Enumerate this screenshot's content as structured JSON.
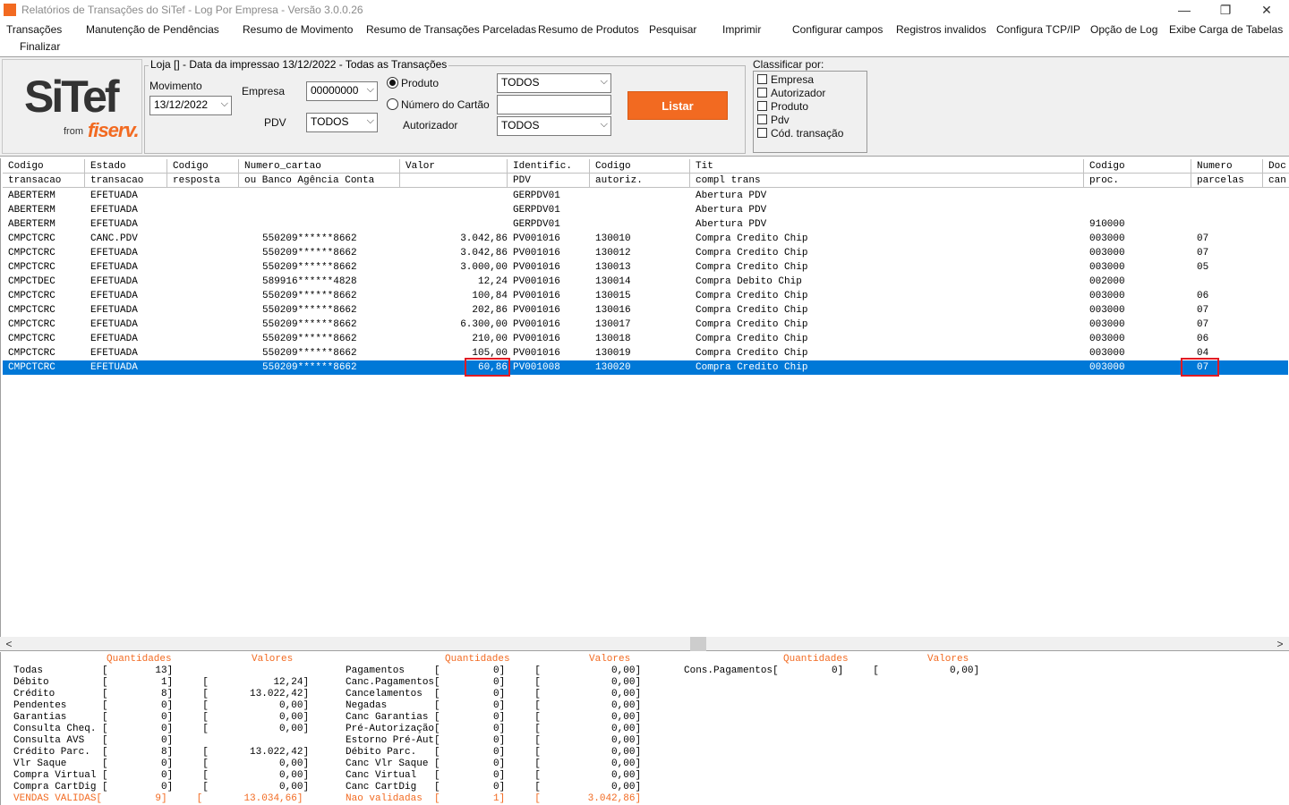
{
  "window": {
    "title": "Relatórios de Transações do SiTef - Log Por Empresa - Versão 3.0.0.26",
    "min_label": "—",
    "max_label": "❐",
    "close_label": "✕"
  },
  "menu": [
    "Transações",
    "Manutenção de Pendências",
    "Resumo de Movimento",
    "Resumo de Transações Parceladas",
    "Resumo de Produtos",
    "Pesquisar",
    "Imprimir",
    "Configurar campos",
    "Registros invalidos",
    "Configura TCP/IP",
    "Opção de Log",
    "Exibe Carga de Tabelas",
    "Finalizar"
  ],
  "logo": {
    "main": "SiTef",
    "from": "from",
    "brand": "fiserv."
  },
  "filters": {
    "group_title": "Loja [] - Data da impressao 13/12/2022 - Todas as Transações",
    "movimento_label": "Movimento",
    "movimento_value": "13/12/2022",
    "empresa_label": "Empresa",
    "empresa_value": "00000000",
    "pdv_label": "PDV",
    "pdv_value": "TODOS",
    "produto_label": "Produto",
    "produto_value": "TODOS",
    "numero_cartao_label": "Número do Cartão",
    "numero_cartao_value": "",
    "autorizador_label": "Autorizador",
    "autorizador_value": "TODOS",
    "listar_label": "Listar",
    "arrow": "⌵"
  },
  "classificar": {
    "title": "Classificar por:",
    "options": [
      "Empresa",
      "Autorizador",
      "Produto",
      "Pdv",
      "Cód. transação"
    ]
  },
  "grid": {
    "header_top": [
      "Codigo",
      "Estado",
      "Codigo",
      "Numero_cartao",
      "Valor",
      "Identific.",
      "Codigo",
      "Tit",
      "Codigo",
      "Numero",
      "Doc"
    ],
    "header_bottom": [
      "transacao",
      "transacao",
      "resposta",
      "ou Banco Agência Conta",
      "",
      "PDV",
      "autoriz.",
      "compl trans",
      "proc.",
      "parcelas",
      "can"
    ],
    "rows": [
      [
        "ABERTERM",
        "EFETUADA",
        "",
        "",
        "",
        "GERPDV01",
        "",
        "Abertura PDV",
        "",
        ""
      ],
      [
        "ABERTERM",
        "EFETUADA",
        "",
        "",
        "",
        "GERPDV01",
        "",
        "Abertura PDV",
        "",
        ""
      ],
      [
        "ABERTERM",
        "EFETUADA",
        "",
        "",
        "",
        "GERPDV01",
        "",
        "Abertura PDV",
        "910000",
        ""
      ],
      [
        "CMPCTCRC",
        "CANC.PDV",
        "",
        "550209******8662",
        "3.042,86",
        "PV001016",
        "130010",
        "Compra Credito Chip",
        "003000",
        "07"
      ],
      [
        "CMPCTCRC",
        "EFETUADA",
        "",
        "550209******8662",
        "3.042,86",
        "PV001016",
        "130012",
        "Compra Credito Chip",
        "003000",
        "07"
      ],
      [
        "CMPCTCRC",
        "EFETUADA",
        "",
        "550209******8662",
        "3.000,00",
        "PV001016",
        "130013",
        "Compra Credito Chip",
        "003000",
        "05"
      ],
      [
        "CMPCTDEC",
        "EFETUADA",
        "",
        "589916******4828",
        "12,24",
        "PV001016",
        "130014",
        "Compra Debito Chip",
        "002000",
        ""
      ],
      [
        "CMPCTCRC",
        "EFETUADA",
        "",
        "550209******8662",
        "100,84",
        "PV001016",
        "130015",
        "Compra Credito Chip",
        "003000",
        "06"
      ],
      [
        "CMPCTCRC",
        "EFETUADA",
        "",
        "550209******8662",
        "202,86",
        "PV001016",
        "130016",
        "Compra Credito Chip",
        "003000",
        "07"
      ],
      [
        "CMPCTCRC",
        "EFETUADA",
        "",
        "550209******8662",
        "6.300,00",
        "PV001016",
        "130017",
        "Compra Credito Chip",
        "003000",
        "07"
      ],
      [
        "CMPCTCRC",
        "EFETUADA",
        "",
        "550209******8662",
        "210,00",
        "PV001016",
        "130018",
        "Compra Credito Chip",
        "003000",
        "06"
      ],
      [
        "CMPCTCRC",
        "EFETUADA",
        "",
        "550209******8662",
        "105,00",
        "PV001016",
        "130019",
        "Compra Credito Chip",
        "003000",
        "04"
      ],
      [
        "CMPCTCRC",
        "EFETUADA",
        "",
        "550209******8662",
        "60,86",
        "PV001008",
        "130020",
        "Compra Credito Chip",
        "003000",
        "07"
      ]
    ],
    "selected_row": 12,
    "left_arrow": "<",
    "right_arrow": ">"
  },
  "summary": {
    "header_quantidades": "Quantidades",
    "header_valores": "Valores",
    "col1": [
      "Todas          [        13]",
      "Débito         [         1]     [           12,24]",
      "Crédito        [         8]     [       13.022,42]",
      "Pendentes      [         0]     [            0,00]",
      "Garantias      [         0]     [            0,00]",
      "Consulta Cheq. [         0]     [            0,00]",
      "Consulta AVS   [         0]",
      "Crédito Parc.  [         8]     [       13.022,42]",
      "Vlr Saque      [         0]     [            0,00]",
      "Compra Virtual [         0]     [            0,00]",
      "Compra CartDig [         0]     [            0,00]",
      "VENDAS VALIDAS[         9]     [       13.034,66]"
    ],
    "col2": [
      "Pagamentos     [         0]     [            0,00]",
      "Canc.Pagamentos[         0]     [            0,00]",
      "Cancelamentos  [         0]     [            0,00]",
      "Negadas        [         0]     [            0,00]",
      "Canc Garantias [         0]     [            0,00]",
      "Pré-Autorização[         0]     [            0,00]",
      "Estorno Pré-Aut[         0]     [            0,00]",
      "Débito Parc.   [         0]     [            0,00]",
      "Canc Vlr Saque [         0]     [            0,00]",
      "Canc Virtual   [         0]     [            0,00]",
      "Canc CartDig   [         0]     [            0,00]",
      "Nao validadas  [         1]     [        3.042,86]"
    ],
    "col3": [
      "Cons.Pagamentos[         0]     [            0,00]"
    ]
  },
  "colors": {
    "accent": "#f26a21",
    "selection": "#0078d7",
    "highlight_box": "#e01b24"
  }
}
